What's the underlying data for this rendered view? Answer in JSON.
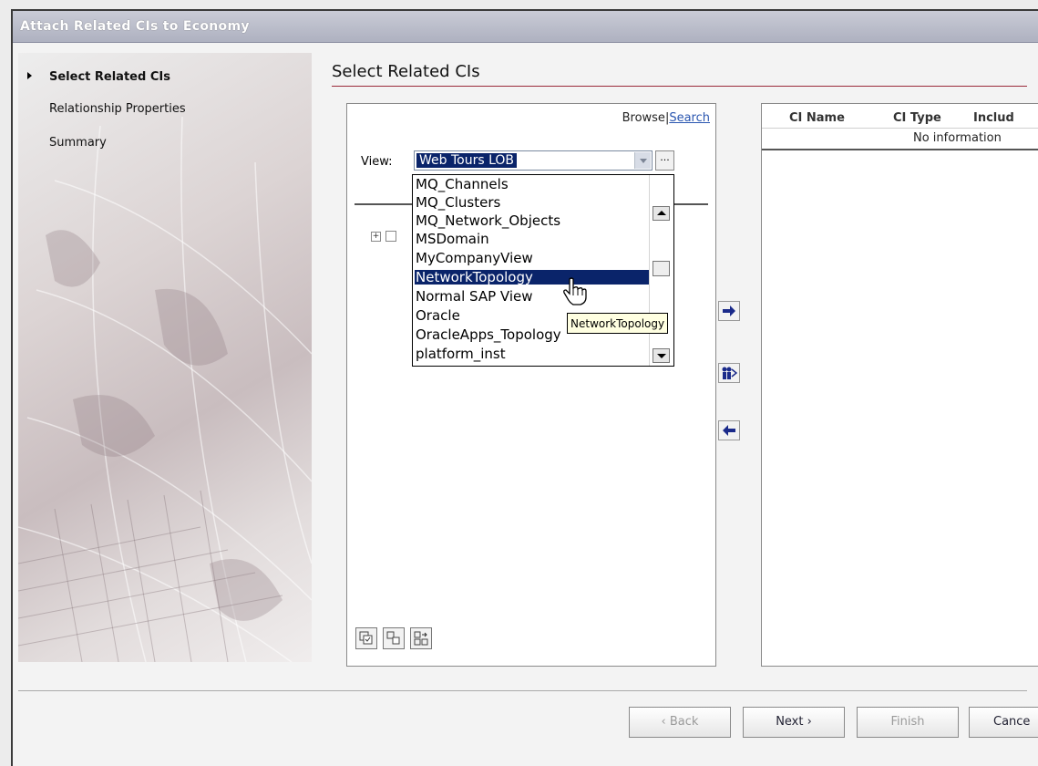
{
  "window": {
    "title": "Attach Related CIs to Economy"
  },
  "wizard": {
    "steps": [
      {
        "label": "Select Related CIs",
        "active": true
      },
      {
        "label": "Relationship Properties",
        "active": false
      },
      {
        "label": "Summary",
        "active": false
      }
    ]
  },
  "main": {
    "heading": "Select Related CIs",
    "browse_label": "Browse",
    "separator": "|",
    "search_label": "Search",
    "view_label": "View:",
    "view_value": "Web Tours LOB",
    "more_button": "...",
    "dropdown_items": [
      "MQ_Channels",
      "MQ_Clusters",
      "MQ_Network_Objects",
      "MSDomain",
      "MyCompanyView",
      "NetworkTopology",
      "Normal SAP View",
      "Oracle",
      "OracleApps_Topology",
      "platform_inst"
    ],
    "dropdown_selected": "NetworkTopology",
    "tooltip": "NetworkTopology",
    "tree_expander": "+"
  },
  "table": {
    "columns": [
      "CI Name",
      "CI Type",
      "Includ"
    ],
    "empty_text": "No information"
  },
  "buttons": {
    "back": "‹ Back",
    "next": "Next ›",
    "finish": "Finish",
    "cancel": "Cance"
  },
  "icons": [
    "add-arrow-icon",
    "add-related-icon",
    "remove-arrow-icon",
    "select-all-icon",
    "tree-icon",
    "invert-selection-icon",
    "hand-cursor-icon"
  ],
  "colors": {
    "selection": "#0a246a",
    "heading_rule": "#9a2a3a",
    "link": "#2a56b0",
    "tooltip_bg": "#ffffe1"
  }
}
